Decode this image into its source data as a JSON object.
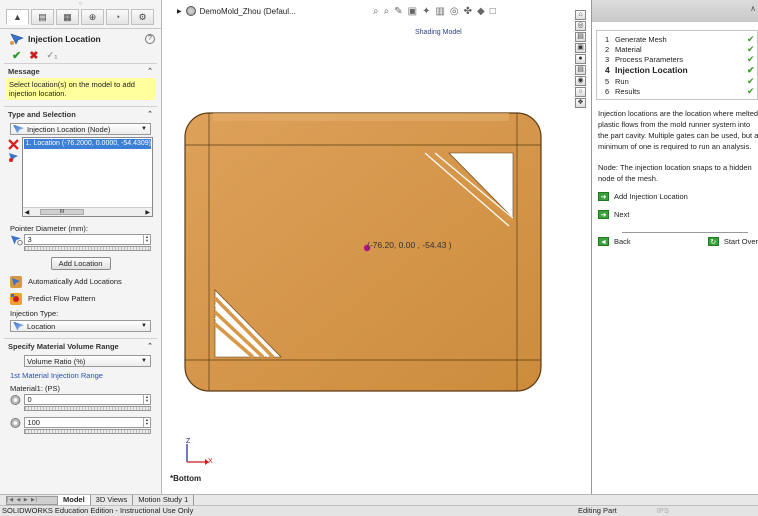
{
  "property_manager": {
    "tab_glyphs": [
      "▲",
      "▤",
      "▦",
      "⊕",
      "◔",
      "⚙"
    ],
    "title": "Injection Location",
    "help_label": "?",
    "message_header": "Message",
    "message_text": "Select location(s) on the model to add injection location.",
    "type_header": "Type and Selection",
    "type_value": "Injection Location (Node)",
    "location_item": "1. Location (-76.2000, 0.0000, -54.4309)",
    "pointer_label": "Pointer Diameter (mm):",
    "pointer_value": "3",
    "add_button": "Add Location",
    "auto_add_label": "Automatically Add Locations",
    "predict_label": "Predict Flow Pattern",
    "injection_type_label": "Injection Type:",
    "injection_type_value": "Location",
    "volume_header": "Specify Material Volume Range",
    "volume_value": "Volume Ratio (%)",
    "range_label": "1st Material Injection Range",
    "material_label": "Material1: (PS)",
    "min_value": "0",
    "max_value": "100"
  },
  "viewport": {
    "doc_title": "DemoMold_Zhou (Defaul...",
    "shading_label": "Shading Model",
    "location_label": "(-76.20, 0.00 , -54.43 )",
    "view_label": "*Bottom",
    "axis_y": "Z",
    "axis_x": "X",
    "toolbar_glyphs": [
      "⌕",
      "⌕",
      "✎",
      "▣",
      "✦",
      "▥",
      "◎",
      "✤",
      "◆",
      "□"
    ]
  },
  "bottom_tabs": {
    "nav": "|◀ ◀ ▶ ▶|",
    "tabs": [
      "Model",
      "3D Views",
      "Motion Study 1"
    ]
  },
  "status": {
    "left": "SOLIDWORKS Education Edition - Instructional Use Only",
    "editing": "Editing Part",
    "units": "IPS"
  },
  "task_pane": {
    "steps": [
      {
        "num": "1",
        "label": "Generate Mesh",
        "check": "✔"
      },
      {
        "num": "2",
        "label": "Material",
        "check": "✔"
      },
      {
        "num": "3",
        "label": "Process Parameters",
        "check": "✔"
      },
      {
        "num": "4",
        "label": "Injection Location",
        "check": "✔"
      },
      {
        "num": "5",
        "label": "Run",
        "check": "✔"
      },
      {
        "num": "6",
        "label": "Results",
        "check": "✔"
      }
    ],
    "description": "Injection locations are the location where melted plastic flows from the mold runner system into the part cavity. Multiple gates can be used, but a minimum of one is required to run an analysis.",
    "note": "Node: The injection location snaps to a hidden node of the mesh.",
    "add_link": "Add Injection Location",
    "next_link": "Next",
    "back_link": "Back",
    "start_over_link": "Start Over"
  },
  "colors": {
    "part_fill": "#d8984a",
    "part_edge": "#5a3a14",
    "selection": "#3b80d6",
    "message_bg": "#ffff9c",
    "injection_point": "#b0148c"
  }
}
